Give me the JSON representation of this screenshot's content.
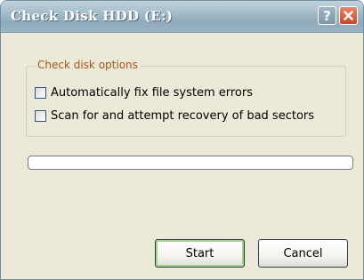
{
  "window": {
    "title": "Check Disk HDD (E:)",
    "help_glyph": "?"
  },
  "options_group": {
    "legend": "Check disk options",
    "options": [
      {
        "label": "Automatically fix file system errors",
        "checked": false
      },
      {
        "label": "Scan for and attempt recovery of bad sectors",
        "checked": false
      }
    ]
  },
  "progress": {
    "value_percent": 0
  },
  "buttons": {
    "start_label": "Start",
    "cancel_label": "Cancel"
  },
  "colors": {
    "title_text": "#ffffff",
    "legend_text": "#a3541a",
    "close_button": "#c5482a",
    "default_button_border": "#a5d08b"
  }
}
